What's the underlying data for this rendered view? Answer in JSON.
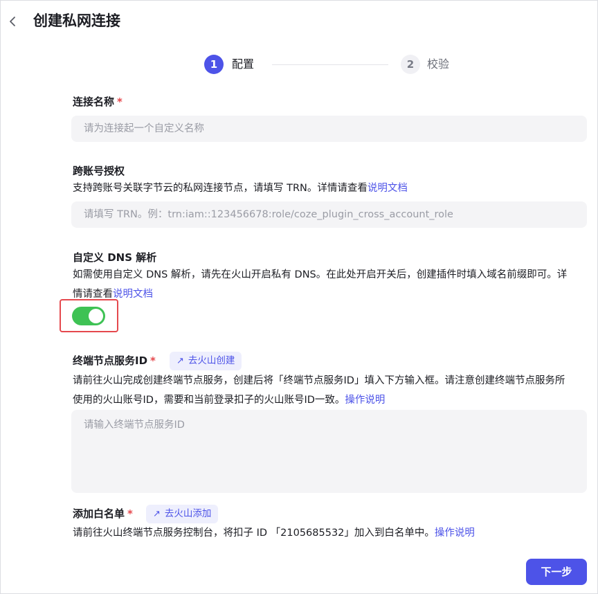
{
  "header": {
    "title": "创建私网连接"
  },
  "steps": [
    {
      "number": "1",
      "label": "配置"
    },
    {
      "number": "2",
      "label": "校验"
    }
  ],
  "connection_name": {
    "label": "连接名称",
    "required_mark": "*",
    "placeholder": "请为连接起一个自定义名称"
  },
  "cross_account": {
    "label": "跨账号授权",
    "desc_text": "支持跨账号关联字节云的私网连接节点，请填写 TRN。详情请查看",
    "desc_link": "说明文档",
    "placeholder": "请填写 TRN。例：trn:iam::123456678:role/coze_plugin_cross_account_role"
  },
  "custom_dns": {
    "label": "自定义 DNS 解析",
    "desc_text": "如需使用自定义 DNS 解析，请先在火山开启私有 DNS。在此处开启开关后，创建插件时填入域名前缀即可。详情请查看",
    "desc_link": "说明文档",
    "toggle_on": true
  },
  "endpoint_service": {
    "label": "终端节点服务ID",
    "required_mark": "*",
    "action_label": "去火山创建",
    "desc_text": "请前往火山完成创建终端节点服务，创建后将「终端节点服务ID」填入下方输入框。请注意创建终端节点服务所使用的火山账号ID，需要和当前登录扣子的火山账号ID一致。",
    "desc_link": "操作说明",
    "placeholder": "请输入终端节点服务ID"
  },
  "whitelist": {
    "label": "添加白名单",
    "required_mark": "*",
    "action_label": "去火山添加",
    "desc_text": "请前往火山终端节点服务控制台，将扣子 ID 「2105685532」加入到白名单中。",
    "desc_link": "操作说明"
  },
  "footer": {
    "next_label": "下一步"
  },
  "colors": {
    "accent": "#4d53e8",
    "toggle_on": "#3ec254",
    "required": "#e5484d",
    "highlight_border": "#e5484d"
  }
}
